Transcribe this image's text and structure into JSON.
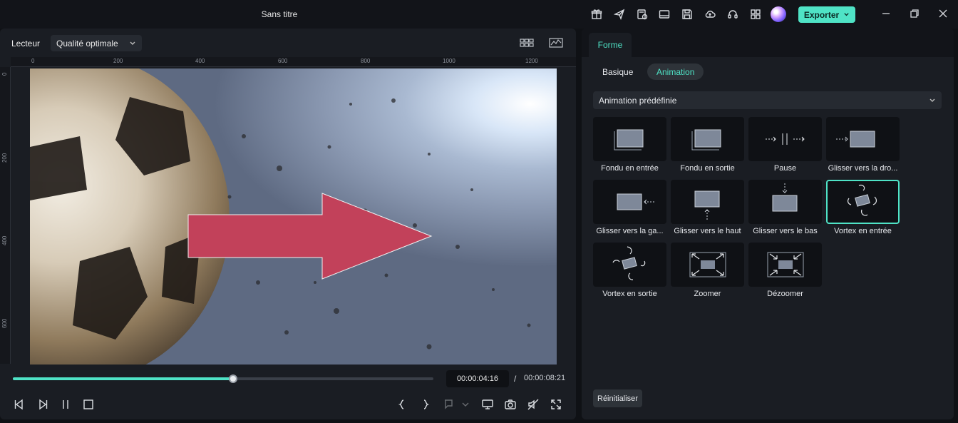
{
  "window": {
    "title": "Sans titre"
  },
  "toolbar": {
    "icons": [
      "gift-icon",
      "send-icon",
      "doc-clock-icon",
      "layout-icon",
      "save-icon",
      "cloud-icon",
      "headset-icon",
      "apps-grid-icon"
    ],
    "export_label": "Exporter"
  },
  "player": {
    "label": "Lecteur",
    "quality": "Qualité optimale",
    "ruler_h": [
      "0",
      "200",
      "400",
      "600",
      "800",
      "1000",
      "1200"
    ],
    "ruler_v": [
      "0",
      "200",
      "400",
      "600"
    ],
    "progress": 0.523,
    "time_current": "00:00:04:16",
    "time_separator": "/",
    "time_total": "00:00:08:21"
  },
  "panel": {
    "tab": "Forme",
    "subtabs": [
      "Basique",
      "Animation"
    ],
    "active_subtab": "Animation",
    "preset_select": "Animation prédéfinie",
    "animations": [
      {
        "label": "Fondu en entrée"
      },
      {
        "label": "Fondu en sortie"
      },
      {
        "label": "Pause"
      },
      {
        "label": "Glisser vers la dro..."
      },
      {
        "label": "Glisser vers la ga..."
      },
      {
        "label": "Glisser vers le haut"
      },
      {
        "label": "Glisser vers le bas"
      },
      {
        "label": "Vortex en entrée"
      },
      {
        "label": "Vortex en sortie"
      },
      {
        "label": "Zoomer"
      },
      {
        "label": "Dézoomer"
      }
    ],
    "selected_animation": "Vortex en entrée",
    "reset_label": "Réinitialiser"
  },
  "colors": {
    "accent": "#4fe3c6",
    "arrow": "#c2415a",
    "background": "#1a1d23"
  }
}
